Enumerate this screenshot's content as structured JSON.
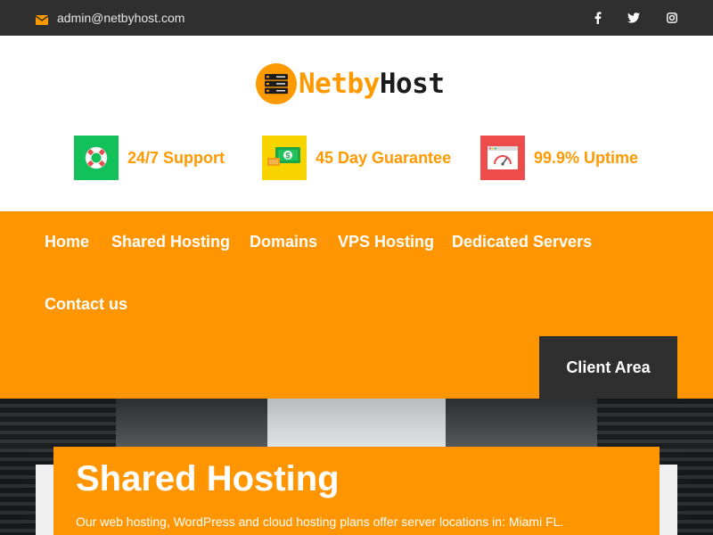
{
  "topbar": {
    "email": "admin@netbyhost.com",
    "email_icon": "envelope-icon",
    "social": [
      {
        "name": "facebook",
        "icon": "facebook-icon"
      },
      {
        "name": "twitter",
        "icon": "twitter-icon"
      },
      {
        "name": "instagram",
        "icon": "instagram-icon"
      }
    ]
  },
  "logo": {
    "text_part1": "Netby",
    "text_part2": "Host",
    "icon": "server-icon"
  },
  "features": [
    {
      "label": "24/7 Support",
      "icon": "lifebuoy-icon",
      "color": "#12c15a"
    },
    {
      "label": "45 Day Guarantee",
      "icon": "money-icon",
      "color": "#f7d400"
    },
    {
      "label": "99.9% Uptime",
      "icon": "browser-gauge-icon",
      "color": "#ec4c4a"
    }
  ],
  "nav": {
    "items": [
      "Home",
      "Shared Hosting",
      "Domains",
      "VPS Hosting",
      "Dedicated Servers",
      "Contact us"
    ],
    "client_area": "Client Area"
  },
  "hero": {
    "title": "Shared Hosting",
    "text": "Our web hosting, WordPress and cloud hosting plans offer server locations in: Miami FL."
  },
  "colors": {
    "accent": "#ff9500",
    "dark": "#2f2f2f",
    "white": "#ffffff"
  }
}
